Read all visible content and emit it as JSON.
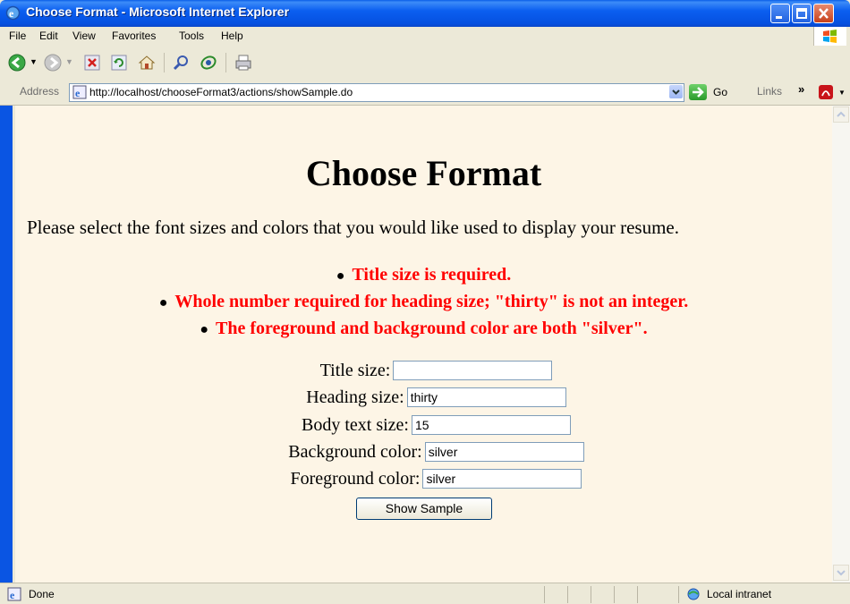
{
  "window": {
    "title": "Choose Format - Microsoft Internet Explorer"
  },
  "menu": [
    "File",
    "Edit",
    "View",
    "Favorites",
    "Tools",
    "Help"
  ],
  "toolbar": {
    "buttons": [
      "back-icon",
      "forward-icon",
      "stop-icon",
      "refresh-icon",
      "home-icon",
      "search-icon",
      "favorites-icon",
      "print-icon"
    ]
  },
  "address": {
    "label": "Address",
    "url": "http://localhost/chooseFormat3/actions/showSample.do",
    "go": "Go",
    "links": "Links",
    "chevron": "»"
  },
  "page": {
    "title": "Choose Format",
    "intro": "Please select the font sizes and colors that you would like used to display your resume.",
    "errors": [
      "Title size is required.",
      "Whole number required for heading size; \"thirty\" is not an integer.",
      "The foreground and background color are both \"silver\"."
    ],
    "fields": [
      {
        "label": "Title size:",
        "value": ""
      },
      {
        "label": "Heading size:",
        "value": "thirty"
      },
      {
        "label": "Body text size:",
        "value": "15"
      },
      {
        "label": "Background color:",
        "value": "silver"
      },
      {
        "label": "Foreground color:",
        "value": "silver"
      }
    ],
    "submit": "Show Sample"
  },
  "status": {
    "text": "Done",
    "zone": "Local intranet"
  },
  "colors": {
    "error": "#ff0000",
    "content_bg": "#fdf5e6",
    "titlebar": "#0a55e3"
  }
}
